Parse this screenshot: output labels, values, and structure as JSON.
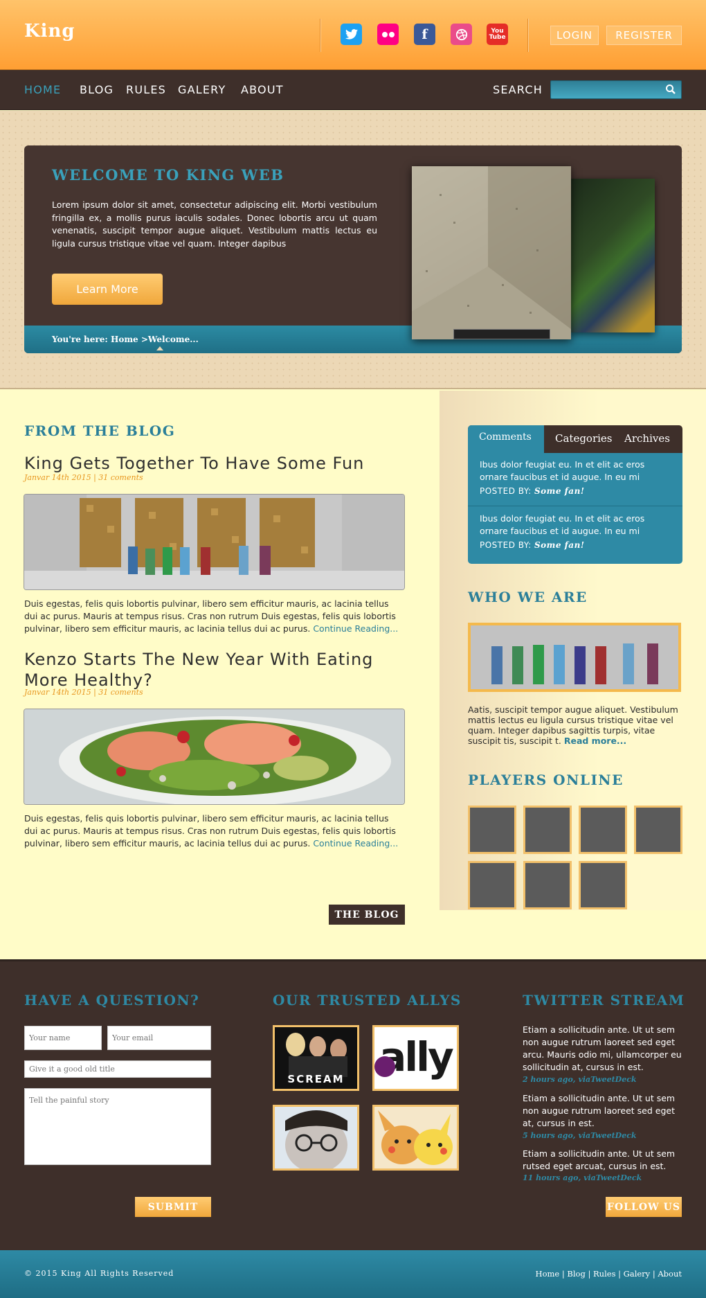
{
  "header": {
    "logo": "King",
    "social": [
      {
        "icon": "twitter-icon",
        "glyph": "t",
        "color": "#1da1f2"
      },
      {
        "icon": "flickr-icon",
        "glyph": "••",
        "color": "#ff0084"
      },
      {
        "icon": "facebook-icon",
        "glyph": "f",
        "color": "#3b5998"
      },
      {
        "icon": "dribbble-icon",
        "glyph": "⊛",
        "color": "#ea4c89"
      },
      {
        "icon": "youtube-icon",
        "glyph": "You",
        "color": "#e52d27"
      }
    ],
    "login": "LOGIN",
    "register": "REGISTER"
  },
  "nav": {
    "items": [
      "HOME",
      "BLOG",
      "RULES",
      "GALERY",
      "ABOUT"
    ],
    "active_color": "#3aa1bb",
    "search_label": "SEARCH"
  },
  "hero": {
    "title": "WELCOME TO KING WEB",
    "text": "Lorem ipsum dolor sit amet, consectetur adipiscing elit. Morbi vestibulum fringilla ex, a mollis purus iaculis sodales. Donec lobortis arcu ut quam venenatis, suscipit tempor augue aliquet. Vestibulum mattis lectus eu ligula cursus tristique vitae vel quam. Integer dapibus",
    "button": "Learn More",
    "breadcrumb": "You're here: Home >Welcome..."
  },
  "blog": {
    "section_title": "FROM THE BLOG",
    "posts": [
      {
        "title": "King Gets Together To Have Some Fun",
        "meta": "Janvar 14th 2015 | 31 coments",
        "text": "Duis egestas, felis quis lobortis pulvinar, libero sem efficitur mauris, ac lacinia tellus dui ac purus. Mauris at tempus risus. Cras non rutrum Duis egestas, felis quis lobortis pulvinar, libero sem efficitur mauris, ac lacinia tellus dui ac purus.",
        "more": "Continue Reading..."
      },
      {
        "title": "Kenzo Starts The New Year With  Eating More Healthy?",
        "meta": "Janvar 14th 2015 | 31 coments",
        "text": "Duis egestas, felis quis lobortis pulvinar, libero sem efficitur mauris, ac lacinia tellus dui ac purus. Mauris at tempus risus. Cras non rutrum Duis egestas, felis quis lobortis pulvinar, libero sem efficitur mauris, ac lacinia tellus dui ac purus.",
        "more": "Continue Reading..."
      }
    ],
    "button": "THE BLOG"
  },
  "sidebar": {
    "tabs": [
      "Comments",
      "Categories",
      "Archives"
    ],
    "comments": [
      {
        "text": "Ibus dolor feugiat eu. In et elit ac eros ornare faucibus et id augue. In eu mi",
        "posted_label": "POSTED BY:",
        "author": "Some fan!"
      },
      {
        "text": "Ibus dolor feugiat eu. In et elit ac eros ornare faucibus et id augue. In eu mi",
        "posted_label": "POSTED BY:",
        "author": "Some fan!"
      }
    ],
    "who_title": "WHO WE ARE",
    "who_text": "Aatis, suscipit tempor augue aliquet. Vestibulum mattis lectus eu ligula cursus tristique vitae vel quam. Integer dapibus sagittis turpis, vitae suscipit tis, suscipit t.",
    "who_more": "Read more...",
    "players_title": "PLAYERS ONLINE"
  },
  "footer": {
    "question_title": "HAVE A QUESTION?",
    "name_placeholder": "Your name",
    "email_placeholder": "Your email",
    "title_placeholder": "Give it a good old title",
    "story_placeholder": "Tell the painful story",
    "submit": "SUBMIT",
    "allys_title": "OUR TRUSTED ALLYS",
    "ally_labels": [
      "SCREAM",
      "ally"
    ],
    "twitter_title": "TWITTER STREAM",
    "tweets": [
      {
        "text": "Etiam a sollicitudin ante. Ut ut sem non augue rutrum laoreet sed eget arcu. Mauris odio mi, ullamcorper eu sollicitudin at, cursus in est.",
        "time": "2 hours ago, viaTweetDeck"
      },
      {
        "text": "Etiam a sollicitudin ante. Ut ut sem non augue rutrum laoreet sed eget at, cursus in est.",
        "time": "5 hours ago, viaTweetDeck"
      },
      {
        "text": "Etiam a sollicitudin ante. Ut ut sem rutsed eget arcuat, cursus in est.",
        "time": "11 hours ago, viaTweetDeck"
      }
    ],
    "follow": "FOLLOW US",
    "copyright": "© 2015 King All Rights Reserved",
    "links": [
      "Home",
      "Blog",
      "Rules",
      "Galery",
      "About"
    ]
  }
}
